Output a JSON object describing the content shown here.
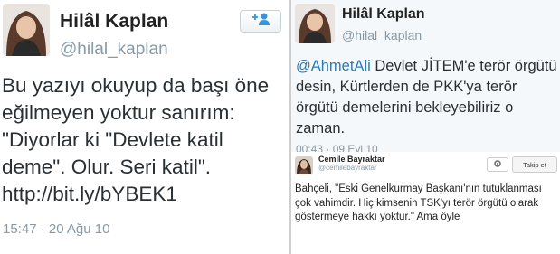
{
  "left_tweet": {
    "name": "Hilâl Kaplan",
    "handle": "@hilal_kaplan",
    "text": "Bu yazıyı okuyup da başı öne eğilmeyen yoktur sanırım: \"Diyorlar ki \"Devlete katil deme\". Olur. Seri katil\". http://bit.ly/bYBEK1",
    "timestamp": "15:47 · 20 Ağu 10",
    "follow_icon": "add-user-icon"
  },
  "right_top_tweet": {
    "name": "Hilâl Kaplan",
    "handle": "@hilal_kaplan",
    "mention": "@AhmetAli",
    "text": " Devlet JİTEM'e terör örgütü desin, Kürtlerden de PKK'ya terör örgütü demelerini bekleyebiliriz o zaman.",
    "timestamp": "00:43 · 09 Eyl 10"
  },
  "right_bottom_tweet": {
    "name": "Cemile Bayraktar",
    "handle": "@cemilebayraktar",
    "gear_icon": "gear-icon",
    "follow_label": "Takip et",
    "text": "Bahçeli, \"Eski Genelkurmay Başkanı'nın tutuklanması çok vahimdir. Hiç kimsenin TSK'yı terör örgütü olarak göstermeye hakkı yoktur.\" Ama öyle"
  },
  "colors": {
    "link": "#2b7bb9",
    "meta": "#8899a6",
    "panel_bg": "#f5f8fa"
  }
}
